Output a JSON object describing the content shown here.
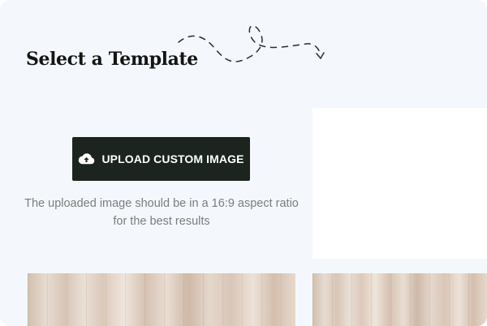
{
  "page": {
    "title": "Select a Template"
  },
  "upload": {
    "button_label": "UPLOAD CUSTOM IMAGE",
    "icon": "cloud-upload-icon",
    "hint": "The uploaded image should be in a 16:9 aspect ratio for the best results"
  },
  "templates": [
    {
      "texture": "light-wood-planks"
    },
    {
      "texture": "light-wood-planks"
    }
  ],
  "colors": {
    "background": "#f4f8fc",
    "button": "#1c241f",
    "button_text": "#ffffff",
    "hint_text": "#7c7c7c",
    "title_text": "#141414"
  }
}
